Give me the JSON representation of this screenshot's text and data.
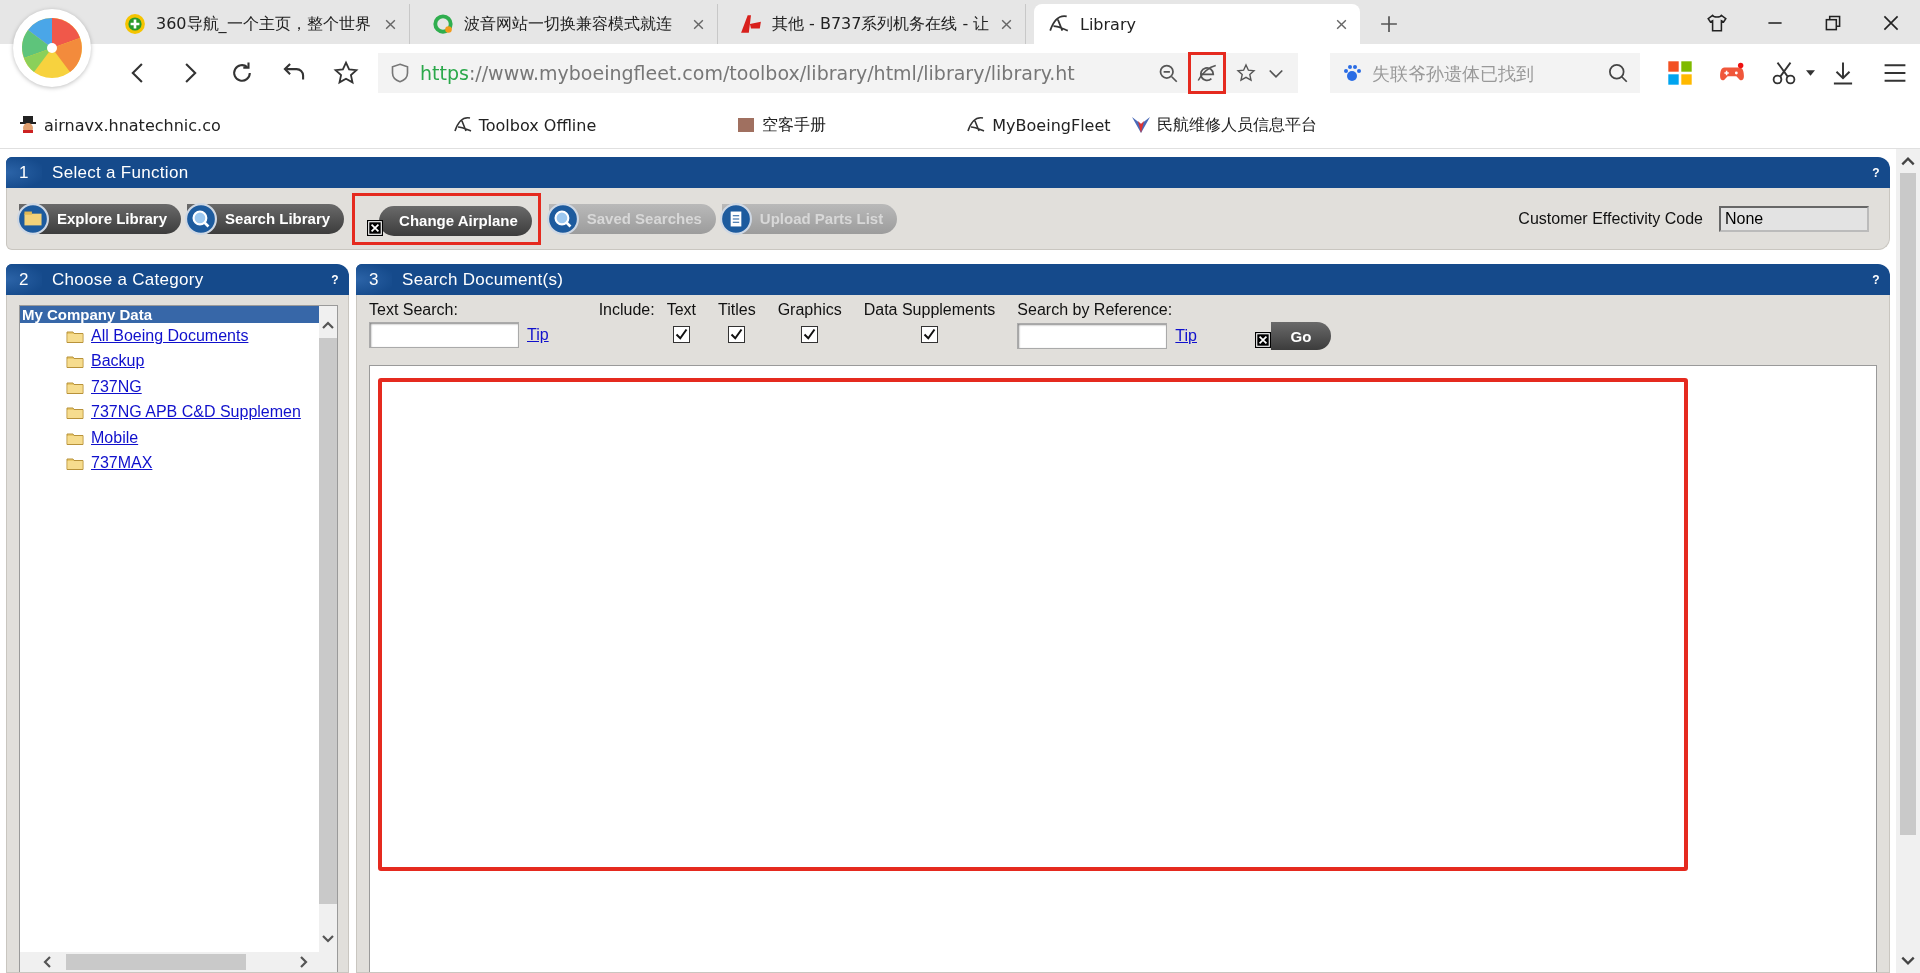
{
  "browser": {
    "tabs": [
      {
        "title": "360导航_一个主页，整个世界",
        "selected": false
      },
      {
        "title": "波音网站一切换兼容模式就连",
        "selected": false
      },
      {
        "title": "其他 - B737系列机务在线 - 让",
        "selected": false
      },
      {
        "title": "Library",
        "selected": true
      }
    ],
    "address": {
      "scheme": "https",
      "rest": "://www.myboeingfleet.com/toolbox/library/html/library/library.ht"
    },
    "search": {
      "placeholder": "失联爷孙遗体已找到"
    },
    "bookmarks": [
      {
        "label": "airnavx.hnatechnic.co"
      },
      {
        "label": "Toolbox Offline"
      },
      {
        "label": "空客手册"
      },
      {
        "label": "MyBoeingFleet"
      },
      {
        "label": "民航维修人员信息平台"
      }
    ]
  },
  "function_panel": {
    "number": "1",
    "title": "Select a Function",
    "help": "?",
    "buttons": [
      {
        "label": "Explore Library",
        "disabled": false
      },
      {
        "label": "Search Library",
        "disabled": false
      },
      {
        "label": "Change Airplane",
        "disabled": false
      },
      {
        "label": "Saved Searches",
        "disabled": true
      },
      {
        "label": "Upload Parts List",
        "disabled": true
      }
    ],
    "effectivity": {
      "label": "Customer Effectivity Code",
      "value": "None"
    }
  },
  "category_panel": {
    "number": "2",
    "title": "Choose a Category",
    "help": "?",
    "tree": {
      "label": "My Company Data",
      "selected": true,
      "children": [
        {
          "label": "All Boeing Documents"
        },
        {
          "label": "Backup"
        },
        {
          "label": "737NG"
        },
        {
          "label": "737NG APB C&D Supplemen"
        },
        {
          "label": "Mobile"
        },
        {
          "label": "737MAX"
        }
      ]
    }
  },
  "search_panel": {
    "number": "3",
    "title": "Search Document(s)",
    "help": "?",
    "text_search": {
      "label": "Text Search:",
      "tip": "Tip"
    },
    "include_label": "Include:",
    "include": [
      {
        "label": "Text",
        "checked": true
      },
      {
        "label": "Titles",
        "checked": true
      },
      {
        "label": "Graphics",
        "checked": true
      },
      {
        "label": "Data Supplements",
        "checked": true
      }
    ],
    "reference": {
      "label": "Search by Reference:",
      "tip": "Tip"
    },
    "go": "Go"
  }
}
